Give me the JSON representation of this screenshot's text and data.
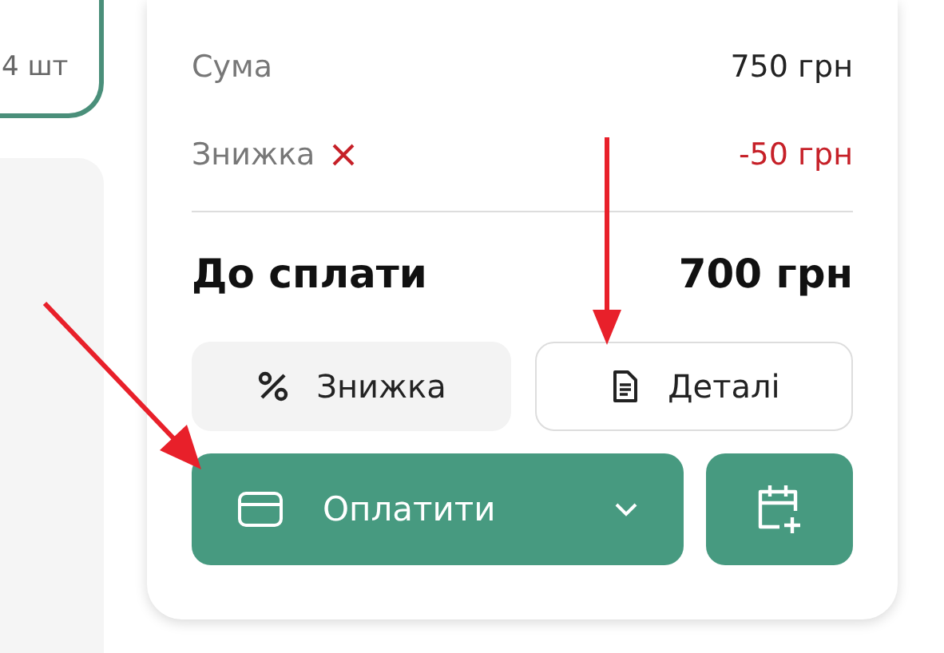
{
  "item_card": {
    "quantity": "4 шт"
  },
  "summary": {
    "rows": [
      {
        "label": "Сума",
        "value": "750 грн",
        "kind": "plain"
      },
      {
        "label": "Знижка",
        "value": "-50 грн",
        "kind": "discount"
      }
    ],
    "total": {
      "label": "До сплати",
      "value": "700 грн"
    }
  },
  "buttons": [
    {
      "label": "Знижка",
      "kind": "discount"
    },
    {
      "label": "Деталі",
      "kind": "details"
    }
  ],
  "pay_button": {
    "label": "Оплатити"
  }
}
